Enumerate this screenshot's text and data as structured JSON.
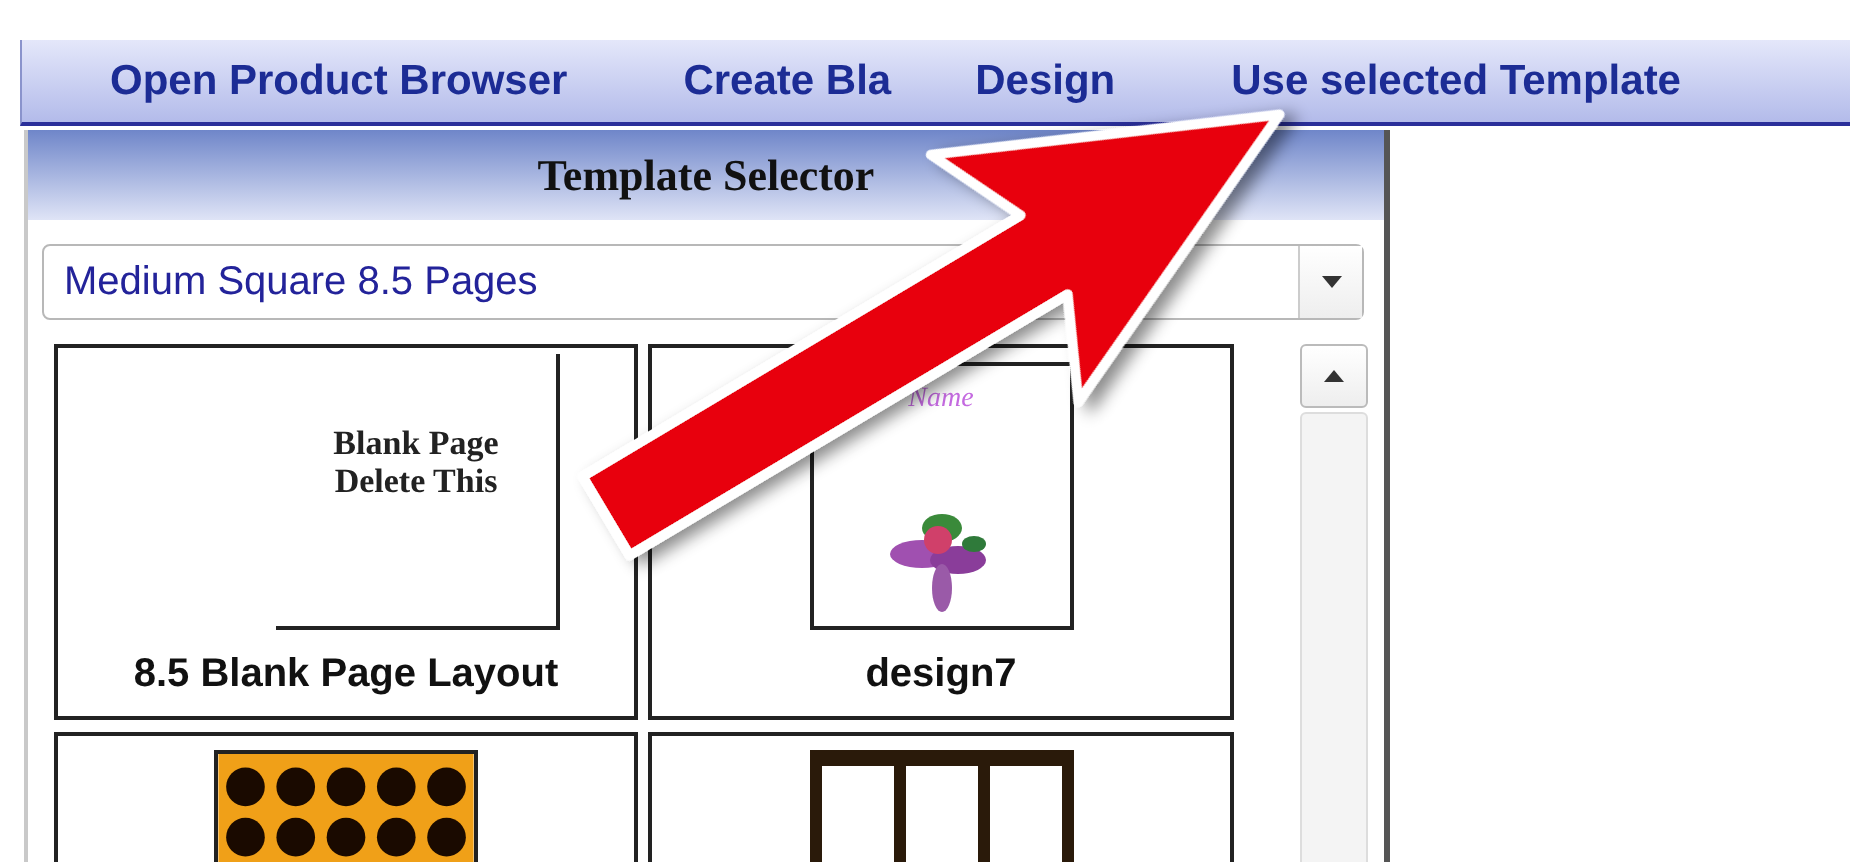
{
  "toolbar": [
    {
      "parts": [
        "Open Product Browser"
      ]
    },
    {
      "parts": [
        "Create Bla",
        "Design"
      ]
    },
    {
      "parts": [
        "Use selected Template"
      ]
    }
  ],
  "panel": {
    "title": "Template Selector",
    "dropdown": {
      "value": "Medium Square 8.5 Pages"
    },
    "templates": [
      {
        "kind": "blank",
        "label": "8.5 Blank Page Layout",
        "page_text": [
          "Blank Page",
          "Delete This"
        ]
      },
      {
        "kind": "design",
        "label": "design7",
        "page_text": [
          "Name"
        ]
      },
      {
        "kind": "dots"
      },
      {
        "kind": "frames"
      }
    ]
  }
}
